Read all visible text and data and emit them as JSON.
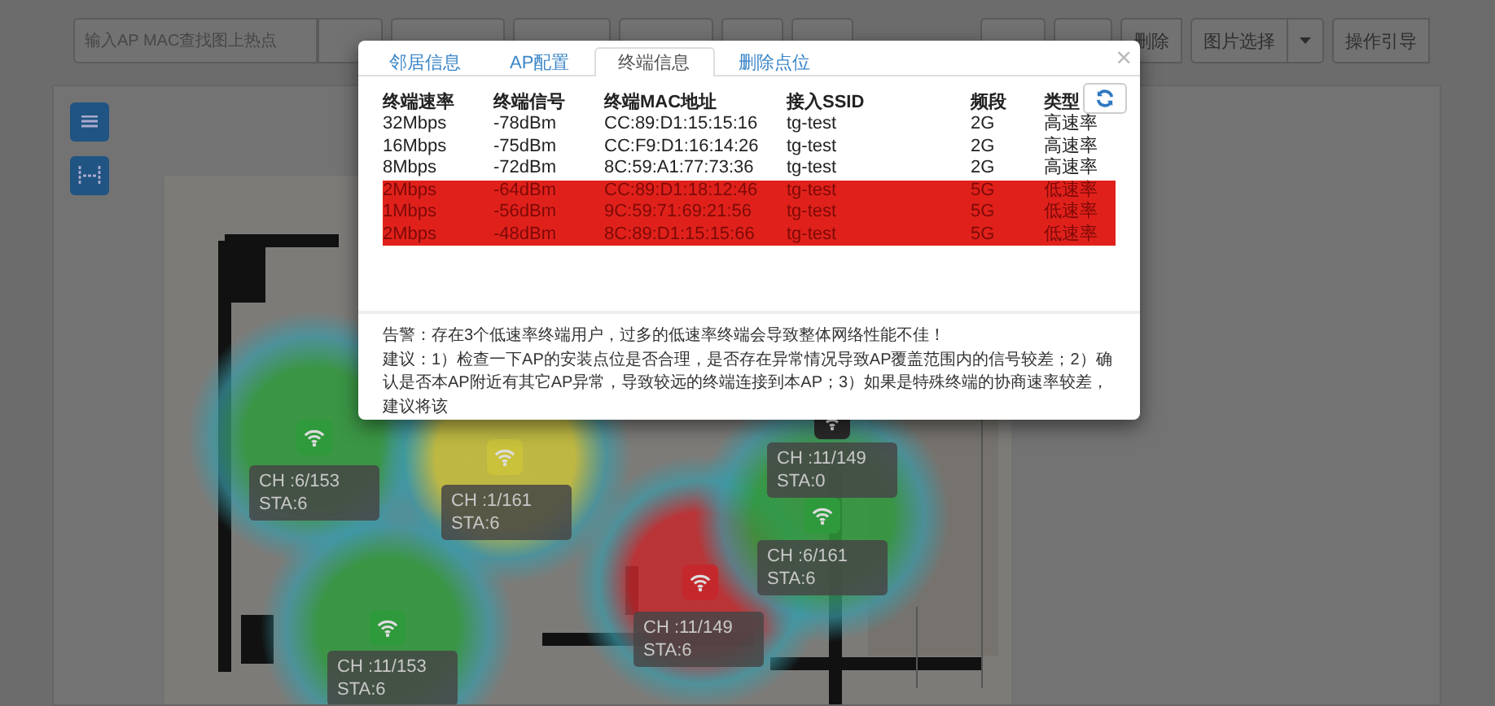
{
  "toolbar": {
    "search": {
      "placeholder": "输入AP MAC查找图上热点"
    },
    "buttons": [
      {
        "label": "删除",
        "dropdown": false
      },
      {
        "label": "图片选择",
        "dropdown": true
      },
      {
        "label": "操作引导",
        "dropdown": false
      }
    ]
  },
  "map": {
    "aps": [
      {
        "channel": "CH :6/153",
        "sta": "STA:6",
        "color": "#2f9a3c"
      },
      {
        "channel": "CH :1/161",
        "sta": "STA:6",
        "color": "#c9c23a"
      },
      {
        "channel": "CH :11/149",
        "sta": "STA:6",
        "color": "#c4282c"
      },
      {
        "channel": "CH :11/153",
        "sta": "STA:6",
        "color": "#2f9a3c"
      },
      {
        "channel": "CH :11/149",
        "sta": "STA:0",
        "color": "#2a2a2a"
      },
      {
        "channel": "CH :6/161",
        "sta": "STA:6",
        "color": "#2f9a3c"
      }
    ]
  },
  "modal": {
    "tabs": [
      {
        "label": "邻居信息",
        "selected": false
      },
      {
        "label": "AP配置",
        "selected": false
      },
      {
        "label": "终端信息",
        "selected": true
      },
      {
        "label": "删除点位",
        "selected": false
      }
    ],
    "close": "×",
    "table": {
      "columns": [
        "终端速率",
        "终端信号",
        "终端MAC地址",
        "接入SSID",
        "频段",
        "类型"
      ],
      "rows": [
        {
          "cells": [
            "32Mbps",
            "-78dBm",
            "CC:89:D1:15:15:16",
            "tg-test",
            "2G",
            "高速率"
          ],
          "low_rate": false
        },
        {
          "cells": [
            "16Mbps",
            "-75dBm",
            "CC:F9:D1:16:14:26",
            "tg-test",
            "2G",
            "高速率"
          ],
          "low_rate": false
        },
        {
          "cells": [
            "8Mbps",
            "-72dBm",
            "8C:59:A1:77:73:36",
            "tg-test",
            "2G",
            "高速率"
          ],
          "low_rate": false
        },
        {
          "cells": [
            "2Mbps",
            "-64dBm",
            "CC:89:D1:18:12:46",
            "tg-test",
            "5G",
            "低速率"
          ],
          "low_rate": true
        },
        {
          "cells": [
            "1Mbps",
            "-56dBm",
            "9C:59:71:69:21:56",
            "tg-test",
            "5G",
            "低速率"
          ],
          "low_rate": true
        },
        {
          "cells": [
            "2Mbps",
            "-48dBm",
            "8C:89:D1:15:15:66",
            "tg-test",
            "5G",
            "低速率"
          ],
          "low_rate": true
        }
      ]
    },
    "alert": "告警：存在3个低速率终端用户，过多的低速率终端会导致整体网络性能不佳！",
    "suggestion": "建议：1）检查一下AP的安装点位是否合理，是否存在异常情况导致AP覆盖范围内的信号较差；2）确认是否本AP附近有其它AP异常，导致较远的终端连接到本AP；3）如果是特殊终端的协商速率较差，建议将该"
  }
}
